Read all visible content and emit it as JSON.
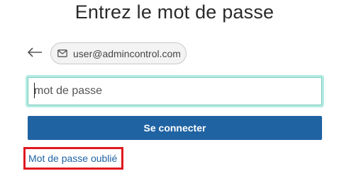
{
  "page": {
    "title": "Entrez le mot de passe"
  },
  "account": {
    "back_icon": "arrow-left-icon",
    "mail_icon": "envelope-icon",
    "email": "user@admincontrol.com"
  },
  "password": {
    "placeholder": "mot de passe",
    "value": ""
  },
  "actions": {
    "submit_label": "Se connecter",
    "forgot_label": "Mot de passe oublié"
  },
  "colors": {
    "primary": "#1f63a3",
    "focus_ring": "#b8ece4",
    "focus_border": "#6ec9bb",
    "highlight": "#e0191e"
  }
}
